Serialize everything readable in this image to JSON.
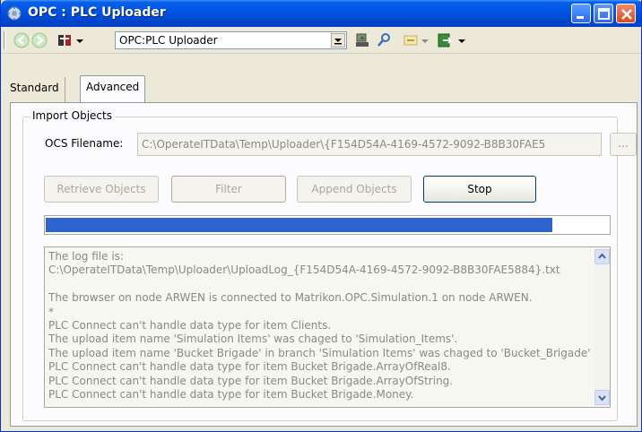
{
  "window": {
    "title": "OPC : PLC Uploader"
  },
  "toolbar": {
    "address_value": "OPC:PLC Uploader",
    "icons": [
      "back-arrow-icon",
      "forward-arrow-icon",
      "tree-view-icon",
      "dropdown-arrow-icon",
      "upload-computer-icon",
      "properties-icon",
      "toggle-icon",
      "exit-icon"
    ]
  },
  "tabs": [
    {
      "label": "Standard",
      "active": false
    },
    {
      "label": "Advanced",
      "active": true
    }
  ],
  "import_group": {
    "legend": "Import Objects",
    "ocs_label": "OCS Filename:",
    "ocs_value": "C:\\OperateITData\\Temp\\Uploader\\{F154D54A-4169-4572-9092-B8B30FAE5",
    "browse_label": "..."
  },
  "buttons": {
    "retrieve": "Retrieve Objects",
    "filter": "Filter",
    "append": "Append Objects",
    "stop": "Stop"
  },
  "progress": {
    "fraction": 0.9
  },
  "log": {
    "lines": [
      "The log file is:",
      "C:\\OperateITData\\Temp\\Uploader\\UploadLog_{F154D54A-4169-4572-9092-B8B30FAE5884}.txt",
      "",
      "The browser on node ARWEN is connected to Matrikon.OPC.Simulation.1 on node ARWEN.",
      "*",
      "PLC Connect can't handle data type for item Clients.",
      "The upload item name 'Simulation Items' was chaged to 'Simulation_Items'.",
      "The upload item name 'Bucket Brigade' in branch 'Simulation Items' was chaged to 'Bucket_Brigade'",
      "PLC Connect can't handle data type for item Bucket Brigade.ArrayOfReal8.",
      "PLC Connect can't handle data type for item Bucket Brigade.ArrayOfString.",
      "PLC Connect can't handle data type for item Bucket Brigade.Money."
    ]
  },
  "colors": {
    "titlebar": "#0055e5",
    "progress": "#2f63d0",
    "dialog_bg": "#ece9d8"
  }
}
